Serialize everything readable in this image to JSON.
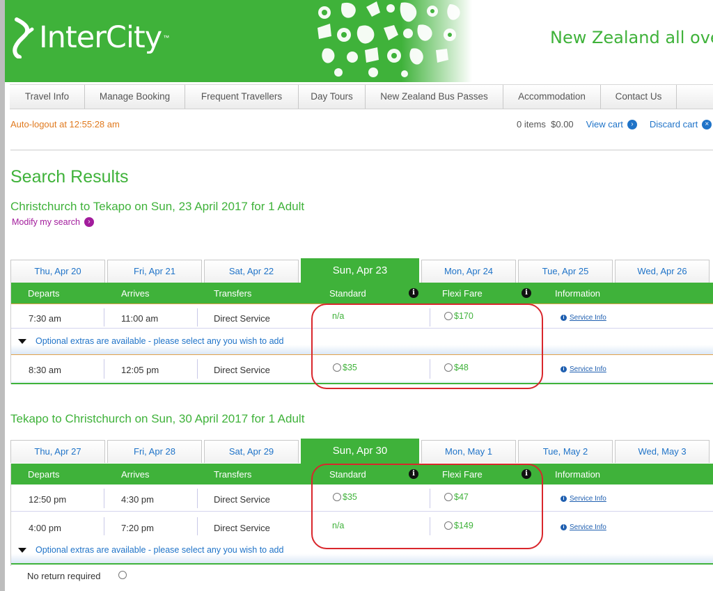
{
  "brand": {
    "logo_text": "InterCity",
    "tagline": "New Zealand all over"
  },
  "nav": {
    "items": [
      {
        "label": "Travel Info",
        "w": 108
      },
      {
        "label": "Manage Booking",
        "w": 144
      },
      {
        "label": "Frequent Travellers",
        "w": 163
      },
      {
        "label": "Day Tours",
        "w": 96
      },
      {
        "label": "New Zealand Bus Passes",
        "w": 198
      },
      {
        "label": "Accommodation",
        "w": 140
      },
      {
        "label": "Contact Us",
        "w": 109
      }
    ]
  },
  "session": {
    "autologout": "Auto-logout at 12:55:28 am"
  },
  "cart": {
    "summary": "0 items  $0.00",
    "view_label": "View cart",
    "discard_label": "Discard cart"
  },
  "page": {
    "title": "Search Results",
    "modify_label": "Modify my search"
  },
  "columns": {
    "departs": "Departs",
    "arrives": "Arrives",
    "transfers": "Transfers",
    "standard": "Standard",
    "flexi": "Flexi Fare",
    "information": "Information"
  },
  "service_info_label": "Service Info",
  "extras_label": "Optional extras are available - please select any you wish to add",
  "outbound": {
    "route": "Christchurch to Tekapo on Sun, 23 April 2017 for 1 Adult",
    "tabs": [
      "Thu, Apr 20",
      "Fri, Apr 21",
      "Sat, Apr 22",
      "Sun, Apr 23",
      "Mon, Apr 24",
      "Tue, Apr 25",
      "Wed, Apr 26"
    ],
    "trips": [
      {
        "departs": "7:30 am",
        "arrives": "11:00 am",
        "transfers": "Direct Service",
        "standard": "n/a",
        "flexi": "$170"
      },
      {
        "departs": "8:30 am",
        "arrives": "12:05 pm",
        "transfers": "Direct Service",
        "standard": "$35",
        "flexi": "$48"
      }
    ]
  },
  "return": {
    "route": "Tekapo to Christchurch on Sun, 30 April 2017 for 1 Adult",
    "tabs": [
      "Thu, Apr 27",
      "Fri, Apr 28",
      "Sat, Apr 29",
      "Sun, Apr 30",
      "Mon, May 1",
      "Tue, May 2",
      "Wed, May 3"
    ],
    "trips": [
      {
        "departs": "12:50 pm",
        "arrives": "4:30 pm",
        "transfers": "Direct Service",
        "standard": "$35",
        "flexi": "$47"
      },
      {
        "departs": "4:00 pm",
        "arrives": "7:20 pm",
        "transfers": "Direct Service",
        "standard": "n/a",
        "flexi": "$149"
      }
    ],
    "no_return_label": "No return required"
  },
  "colors": {
    "brand_green": "#3fb23a",
    "link_blue": "#1f73c8",
    "autologout_orange": "#e07a1f",
    "modify_purple": "#a21c9c",
    "highlight_red": "#d9262c"
  }
}
